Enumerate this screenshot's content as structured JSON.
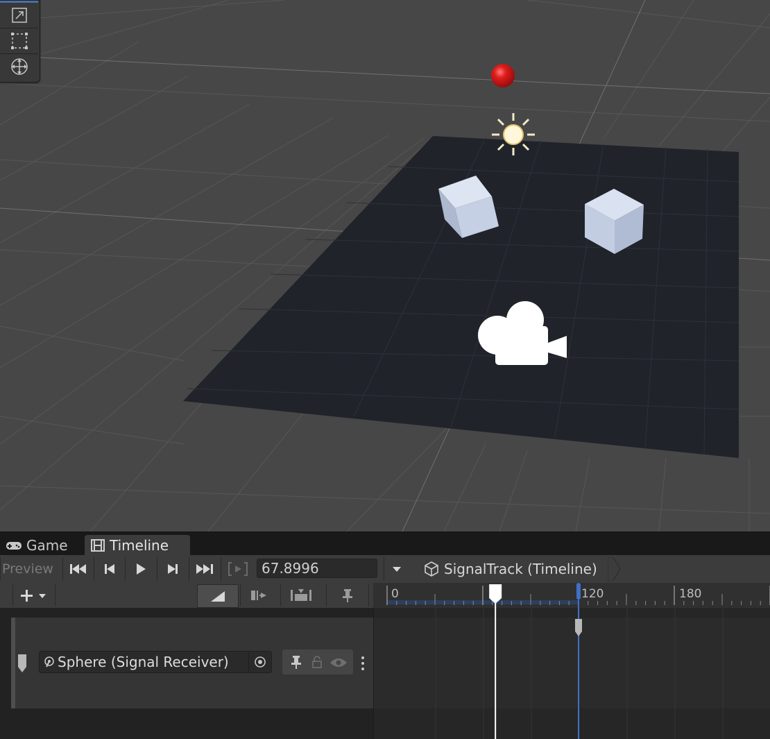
{
  "scene": {
    "objects": [
      "red-sphere",
      "directional-light-icon",
      "cube-left",
      "cube-right",
      "camera-gizmo-icon"
    ],
    "colors": {
      "sky": "#474747",
      "plane": "#20232a",
      "sphere": "#d11a1a",
      "cube": "#c9d3e6"
    }
  },
  "tool_palette": {
    "icons": [
      "transform-icon",
      "rect-tool-icon",
      "move-gizmo-icon"
    ]
  },
  "tabs": [
    {
      "label": "Game",
      "icon": "gamepad-icon",
      "active": false
    },
    {
      "label": "Timeline",
      "icon": "film-icon",
      "active": true
    }
  ],
  "toolbar": {
    "preview_label": "Preview",
    "time_value": "67.8996",
    "breadcrumb": "SignalTrack (Timeline)"
  },
  "ruler": {
    "labels": [
      "0",
      "120",
      "180"
    ],
    "playhead_frame": 67.8996
  },
  "track": {
    "binding_label": "Sphere (Signal Receiver)",
    "signal_marker_frame": 120
  },
  "accent": "#3f6fc6"
}
